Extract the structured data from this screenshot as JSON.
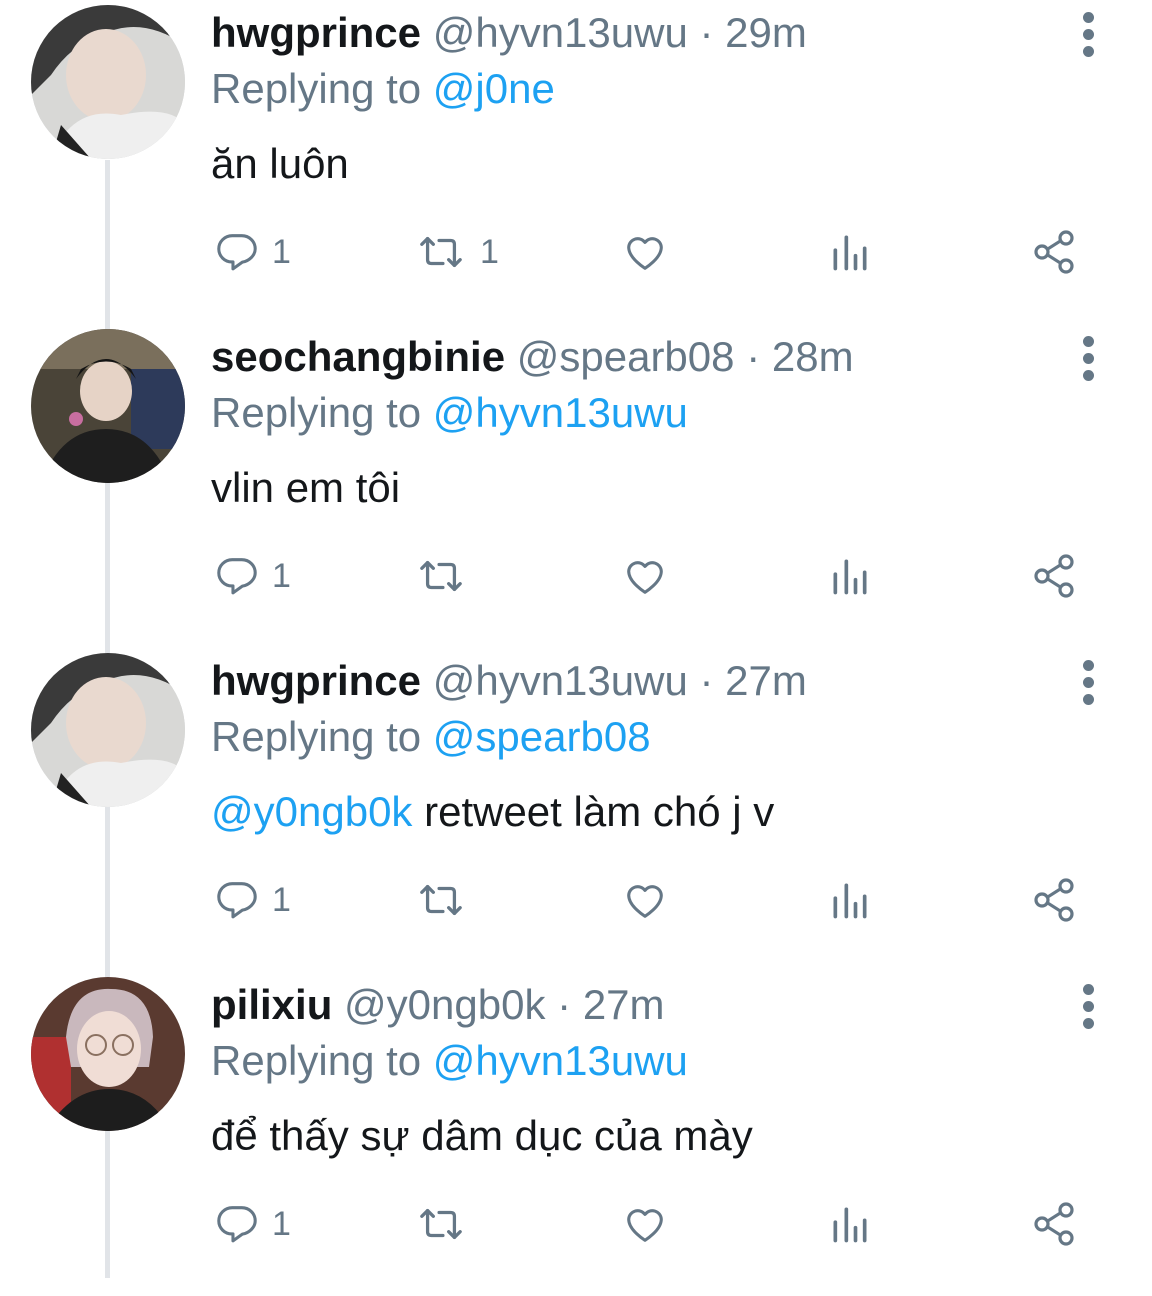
{
  "tweets": [
    {
      "name": "hwgprince",
      "handle": "@hyvn13uwu",
      "separator": "·",
      "time": "29m",
      "replying_label": "Replying to",
      "replying_to": "@j0ne",
      "text_mention": "",
      "text": "ăn luôn",
      "reply_count": "1",
      "retweet_count": "1",
      "like_count": ""
    },
    {
      "name": "seochangbinie",
      "handle": "@spearb08",
      "separator": "·",
      "time": "28m",
      "replying_label": "Replying to",
      "replying_to": "@hyvn13uwu",
      "text_mention": "",
      "text": "vlin em tôi",
      "reply_count": "1",
      "retweet_count": "",
      "like_count": ""
    },
    {
      "name": "hwgprince",
      "handle": "@hyvn13uwu",
      "separator": "·",
      "time": "27m",
      "replying_label": "Replying to",
      "replying_to": "@spearb08",
      "text_mention": "@y0ngb0k",
      "text": " retweet làm chó j v",
      "reply_count": "1",
      "retweet_count": "",
      "like_count": ""
    },
    {
      "name": "pilixiu",
      "handle": "@y0ngb0k",
      "separator": "·",
      "time": "27m",
      "replying_label": "Replying to",
      "replying_to": "@hyvn13uwu",
      "text_mention": "",
      "text": "để thấy sự dâm dục của mày",
      "reply_count": "1",
      "retweet_count": "",
      "like_count": ""
    }
  ],
  "icons": {
    "reply": "reply-icon",
    "retweet": "retweet-icon",
    "like": "heart-icon",
    "stats": "stats-icon",
    "share": "share-icon",
    "more": "more-vertical-icon"
  },
  "colors": {
    "accent": "#1da1f2",
    "secondary_text": "#657786",
    "primary_text": "#14171a",
    "thread_line": "#e1e4e8"
  }
}
